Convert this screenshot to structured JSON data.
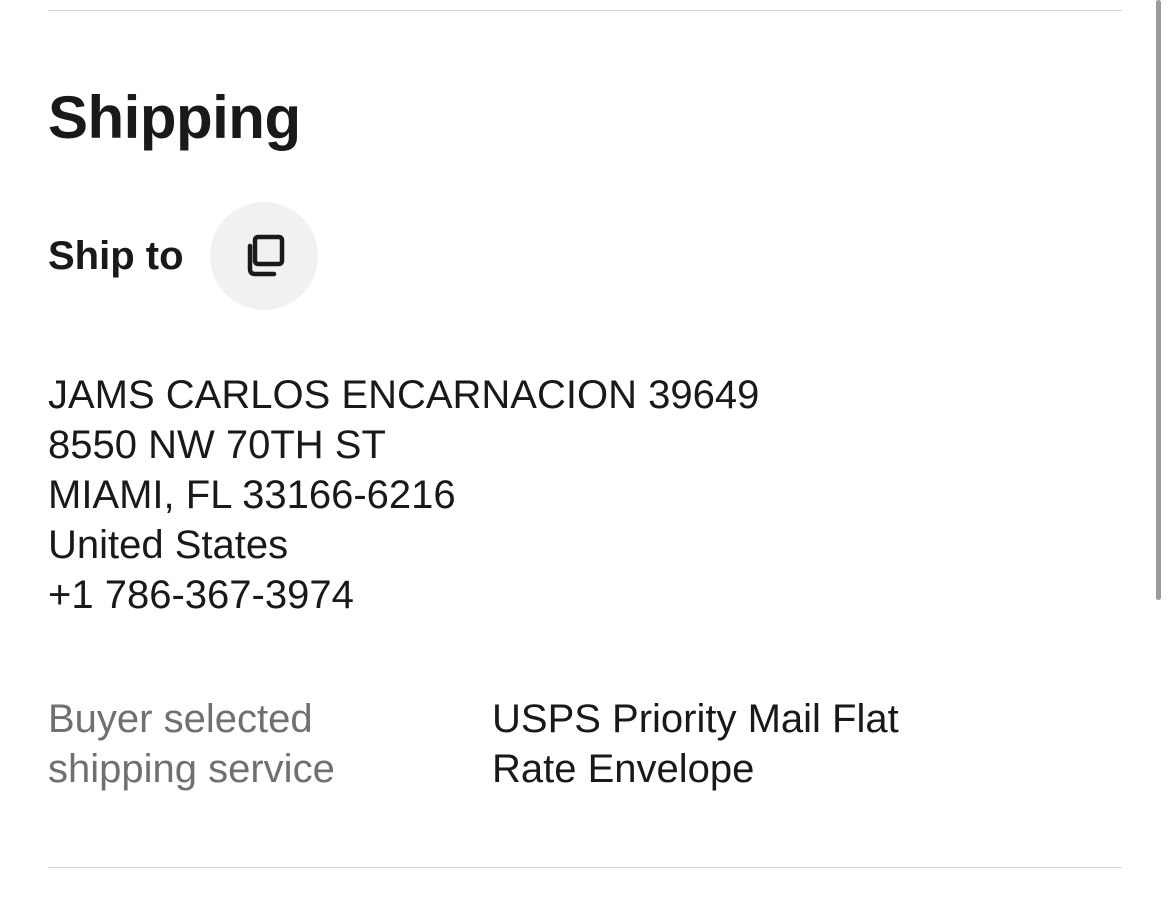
{
  "shipping": {
    "title": "Shipping",
    "ship_to_label": "Ship to",
    "copy_icon": "copy-icon",
    "address": {
      "name": "JAMS CARLOS ENCARNACION 39649",
      "street": "8550 NW 70TH ST",
      "city_state_zip": "MIAMI, FL 33166-6216",
      "country": "United States",
      "phone": "+1 786-367-3974"
    },
    "service_label": "Buyer selected shipping service",
    "service_value": "USPS Priority Mail Flat Rate Envelope"
  }
}
